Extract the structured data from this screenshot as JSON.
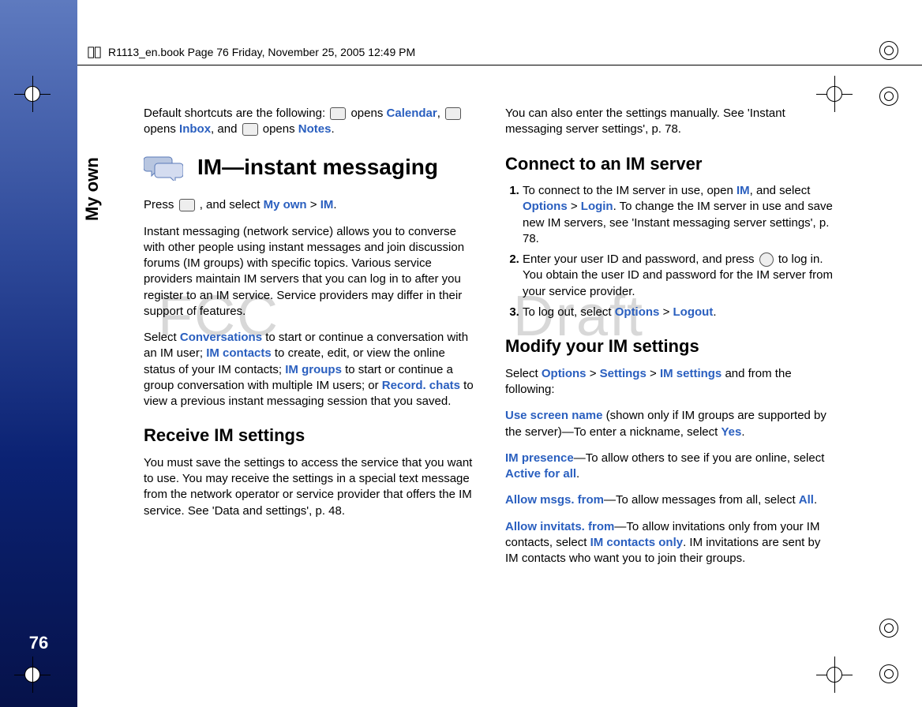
{
  "header": {
    "text": "R1113_en.book  Page 76  Friday, November 25, 2005  12:49 PM"
  },
  "sidebar": {
    "label": "My own",
    "page_number": "76"
  },
  "watermarks": {
    "left": "FCC",
    "right": "Draft"
  },
  "left_col": {
    "intro_pre": "Default shortcuts are the following: ",
    "intro_opens1": " opens ",
    "calendar": "Calendar",
    "intro_comma": ", ",
    "intro_opens2": " opens ",
    "inbox": "Inbox",
    "intro_and": ", and ",
    "intro_opens3": " opens ",
    "notes": "Notes",
    "intro_period": ".",
    "h1": "IM—instant messaging",
    "press_pre": "Press ",
    "press_mid": " , and select ",
    "myown": "My own",
    "gt": " > ",
    "im": "IM",
    "press_end": ".",
    "im_para": "Instant messaging (network service) allows you to converse with other people using instant messages and join discussion forums (IM groups) with specific topics. Various service providers maintain IM servers that you can log in to after you register to an IM service. Service providers may differ in their support of features.",
    "select_pre": "Select ",
    "conversations": "Conversations",
    "select_mid1": " to start or continue a conversation with an IM user; ",
    "imcontacts": "IM contacts",
    "select_mid2": " to create, edit, or view the online status of your IM contacts; ",
    "imgroups": "IM groups",
    "select_mid3": " to start or continue a group conversation with multiple IM users; or ",
    "recordchats": "Record. chats",
    "select_end": " to view a previous instant messaging session that you saved.",
    "h3_receive": "Receive IM settings",
    "receive_para": "You must save the settings to access the service that you want to use. You may receive the settings in a special text message from the network operator or service provider that offers the IM service. See 'Data and settings', p. 48."
  },
  "right_col": {
    "manual_para": "You can also enter the settings manually. See 'Instant messaging server settings', p. 78.",
    "h3_connect": "Connect to an IM server",
    "step1_pre": "To connect to the IM server in use, open ",
    "im": "IM",
    "step1_mid1": ", and select ",
    "options": "Options",
    "gt": " > ",
    "login": "Login",
    "step1_end": ". To change the IM server in use and save new IM servers, see 'Instant messaging server settings', p. 78.",
    "step2_pre": "Enter your user ID and password, and press ",
    "step2_end": " to log in. You obtain the user ID and password for the IM server from your service provider.",
    "step3_pre": "To log out, select ",
    "logout": "Logout",
    "step3_end": ".",
    "h3_modify": "Modify your IM settings",
    "modify_pre": "Select ",
    "settings": "Settings",
    "imsettings": "IM settings",
    "modify_end": " and from the following:",
    "usescreen": "Use screen name",
    "usescreen_text": " (shown only if IM groups are supported by the server)—To enter a nickname, select ",
    "yes": "Yes",
    "period": ".",
    "impresence": "IM presence",
    "impresence_text": "—To allow others to see if you are online, select ",
    "activeforall": "Active for all",
    "allowmsgs": "Allow msgs. from",
    "allowmsgs_text": "—To allow messages from all, select ",
    "all": "All",
    "allowinvit": "Allow invitats. from",
    "allowinvit_text": "—To allow invitations only from your IM contacts, select ",
    "imcontactsonly": "IM contacts only",
    "allowinvit_end": ". IM invitations are sent by IM contacts who want you to join their groups."
  }
}
